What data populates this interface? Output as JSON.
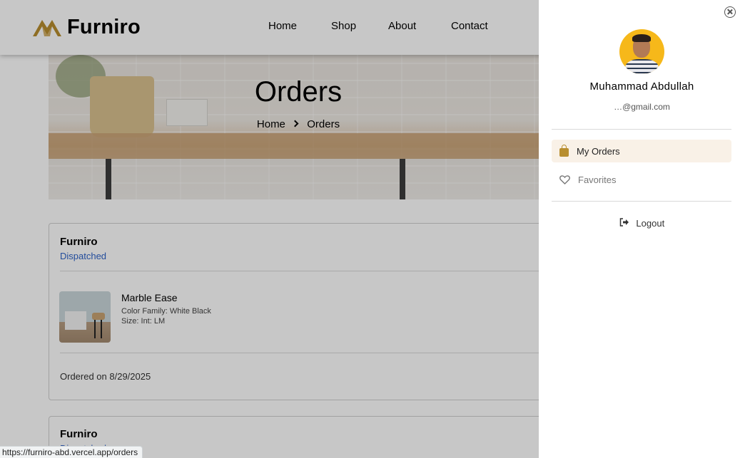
{
  "header": {
    "brand": "Furniro",
    "nav": [
      "Home",
      "Shop",
      "About",
      "Contact"
    ]
  },
  "hero": {
    "title": "Orders",
    "breadcrumb": [
      "Home",
      "Orders"
    ]
  },
  "orders": [
    {
      "store": "Furniro",
      "status": "Dispatched",
      "product": {
        "name": "Marble Ease",
        "color_family": "Color Family: White Black",
        "size": "Size: Int: LM"
      },
      "ordered_on": "Ordered on 8/29/2025"
    },
    {
      "store": "Furniro",
      "status": "Dispatched"
    }
  ],
  "drawer": {
    "user_name": "Muhammad Abdullah",
    "email": "…@gmail.com",
    "menu": [
      {
        "label": "My Orders",
        "icon": "bag-icon",
        "active": true
      },
      {
        "label": "Favorites",
        "icon": "heart-icon",
        "active": false
      }
    ],
    "logout": "Logout"
  },
  "status_bar_url": "https://furniro-abd.vercel.app/orders",
  "colors": {
    "accent": "#b88e2f",
    "status_blue": "#2e63c8",
    "active_menu_bg": "#f9f1e7"
  }
}
